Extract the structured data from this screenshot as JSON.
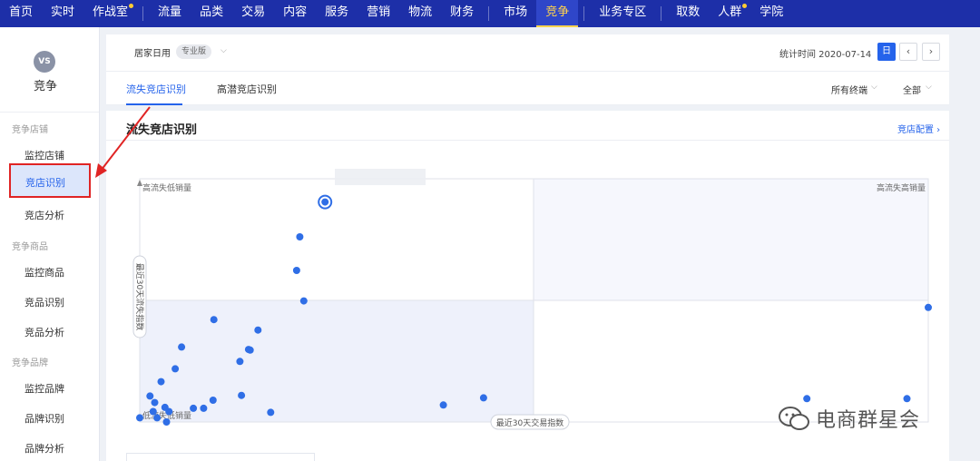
{
  "topnav": {
    "items": [
      {
        "label": "首页",
        "active": false,
        "dot": false
      },
      {
        "label": "实时",
        "active": false,
        "dot": false
      },
      {
        "label": "作战室",
        "active": false,
        "dot": true
      },
      {
        "sep": true
      },
      {
        "label": "流量",
        "active": false,
        "dot": false
      },
      {
        "label": "品类",
        "active": false,
        "dot": false
      },
      {
        "label": "交易",
        "active": false,
        "dot": false
      },
      {
        "label": "内容",
        "active": false,
        "dot": false
      },
      {
        "label": "服务",
        "active": false,
        "dot": false
      },
      {
        "label": "营销",
        "active": false,
        "dot": false
      },
      {
        "label": "物流",
        "active": false,
        "dot": false
      },
      {
        "label": "财务",
        "active": false,
        "dot": false
      },
      {
        "sep": true
      },
      {
        "label": "市场",
        "active": false,
        "dot": false
      },
      {
        "label": "竞争",
        "active": true,
        "dot": false
      },
      {
        "sep": true
      },
      {
        "label": "业务专区",
        "active": false,
        "dot": false
      },
      {
        "sep": true
      },
      {
        "label": "取数",
        "active": false,
        "dot": false
      },
      {
        "label": "人群",
        "active": false,
        "dot": true
      },
      {
        "label": "学院",
        "active": false,
        "dot": false
      }
    ]
  },
  "sidebar": {
    "logo_text": "VS",
    "title": "竞争",
    "groups": [
      {
        "label": "竞争店铺",
        "items": [
          "监控店铺",
          "竞店识别",
          "竞店分析"
        ]
      },
      {
        "label": "竞争商品",
        "items": [
          "监控商品",
          "竞品识别",
          "竞品分析"
        ]
      },
      {
        "label": "竞争品牌",
        "items": [
          "监控品牌",
          "品牌识别",
          "品牌分析"
        ]
      }
    ],
    "active_item": "竞店识别"
  },
  "filterbar": {
    "category": "居家日用",
    "edition": "专业版",
    "stat_time": "统计时间 2020-07-14",
    "day_button": "日",
    "prev": "‹",
    "next": "›"
  },
  "tabs": {
    "items": [
      "流失竞店识别",
      "高潜竞店识别"
    ],
    "active": 0,
    "terminal": "所有终端",
    "scope": "全部"
  },
  "card": {
    "title": "流失竞店识别",
    "config_link": "竞店配置 ›"
  },
  "chart_data": {
    "type": "scatter",
    "quadrant_labels": {
      "top_left": "高流失低销量",
      "top_right": "高流失高销量",
      "bottom_left": "低流失低销量"
    },
    "xlabel": "最近30天交易指数",
    "ylabel": "最近30天流失指数",
    "grid": true,
    "highlight": {
      "x": 0.235,
      "y": 1.01
    },
    "points": [
      {
        "x": 0.203,
        "y": 0.85
      },
      {
        "x": 0.199,
        "y": 0.696
      },
      {
        "x": 0.208,
        "y": 0.556
      },
      {
        "x": 0.094,
        "y": 0.47
      },
      {
        "x": 0.15,
        "y": 0.422
      },
      {
        "x": 0.138,
        "y": 0.333
      },
      {
        "x": 0.053,
        "y": 0.344
      },
      {
        "x": 0.14,
        "y": 0.33
      },
      {
        "x": 0.127,
        "y": 0.278
      },
      {
        "x": 0.045,
        "y": 0.244
      },
      {
        "x": 0.027,
        "y": 0.185
      },
      {
        "x": 0.013,
        "y": 0.119
      },
      {
        "x": 0.019,
        "y": 0.089
      },
      {
        "x": 0.093,
        "y": 0.1
      },
      {
        "x": 0.129,
        "y": 0.122
      },
      {
        "x": 0.032,
        "y": 0.067
      },
      {
        "x": 0.068,
        "y": 0.063
      },
      {
        "x": 0.081,
        "y": 0.063
      },
      {
        "x": 0.017,
        "y": 0.048
      },
      {
        "x": 0.037,
        "y": 0.048
      },
      {
        "x": 0.166,
        "y": 0.044
      },
      {
        "x": 0.0,
        "y": 0.019
      },
      {
        "x": 0.022,
        "y": 0.019
      },
      {
        "x": 0.034,
        "y": 0.0
      },
      {
        "x": 0.385,
        "y": 0.078
      },
      {
        "x": 0.436,
        "y": 0.111
      },
      {
        "x": 0.846,
        "y": 0.107
      },
      {
        "x": 0.973,
        "y": 0.107
      },
      {
        "x": 1.0,
        "y": 0.526
      }
    ]
  },
  "watermark": {
    "text": "电商群星会"
  }
}
